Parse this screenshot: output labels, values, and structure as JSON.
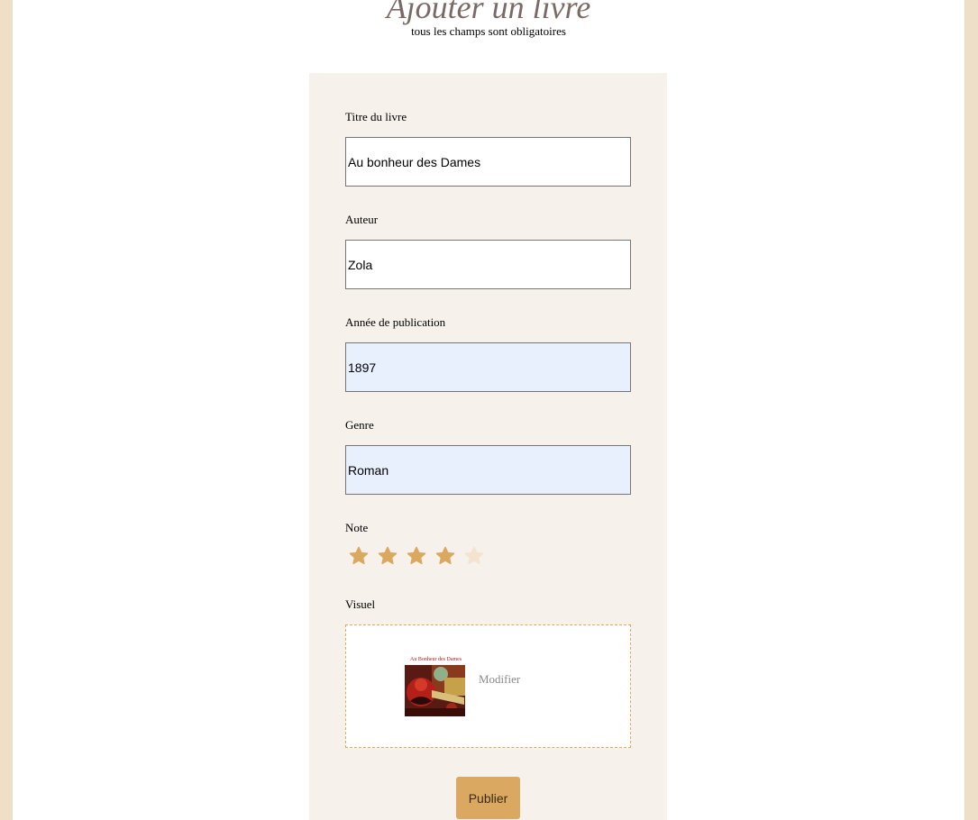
{
  "header": {
    "title": "Ajouter un livre",
    "subtitle": "tous les champs sont obligatoires"
  },
  "form": {
    "title_field": {
      "label": "Titre du livre",
      "value": "Au bonheur des Dames"
    },
    "author_field": {
      "label": "Auteur",
      "value": "Zola"
    },
    "year_field": {
      "label": "Année de publication",
      "value": "1897"
    },
    "genre_field": {
      "label": "Genre",
      "value": "Roman"
    },
    "rating": {
      "label": "Note",
      "value": 4,
      "max": 5,
      "filled_color": "#dba862",
      "empty_color": "#f3e3cf"
    },
    "visual": {
      "label": "Visuel",
      "cover_title": "Au Bonheur des Dames",
      "modify_label": "Modifier"
    },
    "publish_label": "Publier"
  },
  "colors": {
    "background": "#eddfc8",
    "panel": "#f6f1eb",
    "accent": "#dba862",
    "title": "#7a6a66",
    "autofill": "#e8f0fe"
  }
}
